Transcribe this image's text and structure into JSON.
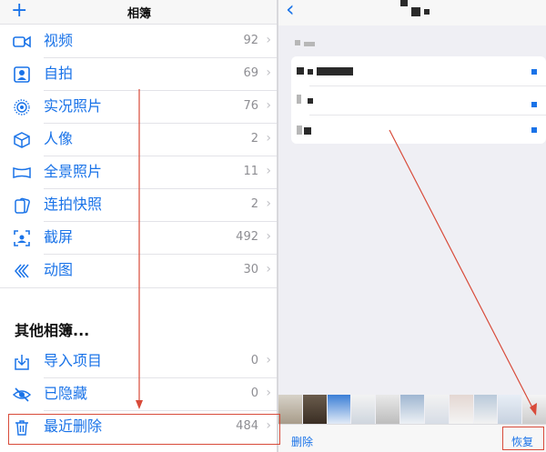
{
  "left": {
    "title": "相簿",
    "items": [
      {
        "label": "视频",
        "count": "92",
        "icon": "video-icon"
      },
      {
        "label": "自拍",
        "count": "69",
        "icon": "selfie-icon"
      },
      {
        "label": "实况照片",
        "count": "76",
        "icon": "live-photo-icon"
      },
      {
        "label": "人像",
        "count": "2",
        "icon": "portrait-cube-icon"
      },
      {
        "label": "全景照片",
        "count": "11",
        "icon": "panorama-icon"
      },
      {
        "label": "连拍快照",
        "count": "2",
        "icon": "burst-icon"
      },
      {
        "label": "截屏",
        "count": "492",
        "icon": "screenshot-icon"
      },
      {
        "label": "动图",
        "count": "30",
        "icon": "animated-icon"
      }
    ],
    "other_section_title": "其他相簿...",
    "other_items": [
      {
        "label": "导入项目",
        "count": "0",
        "icon": "import-icon"
      },
      {
        "label": "已隐藏",
        "count": "0",
        "icon": "hidden-eye-icon"
      },
      {
        "label": "最近删除",
        "count": "484",
        "icon": "trash-icon"
      }
    ],
    "chevron": "›"
  },
  "right": {
    "back": "‹",
    "toolbar": {
      "delete_label": "删除",
      "recover_label": "恢复"
    }
  },
  "colors": {
    "accent": "#1a73e8",
    "annotation": "#d84b3a"
  }
}
